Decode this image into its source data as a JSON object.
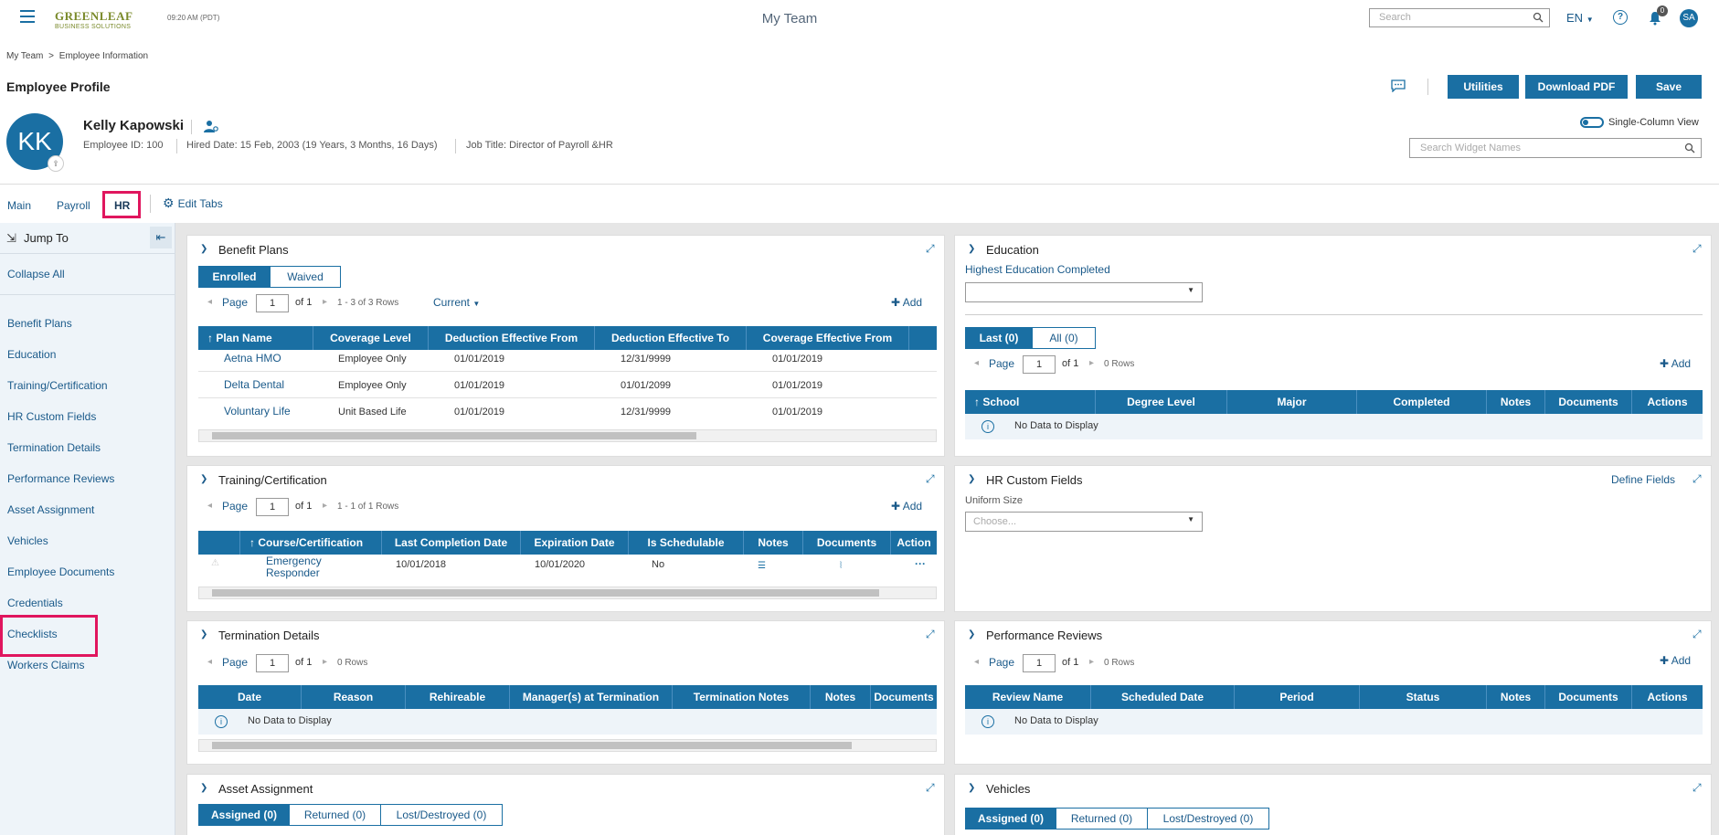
{
  "header": {
    "logo_line1": "GREENLEAF",
    "logo_line2": "BUSINESS SOLUTIONS",
    "time": "09:20 AM (PDT)",
    "app_title": "My Team",
    "search_placeholder": "Search",
    "lang": "EN",
    "notif_count": "0",
    "user_initials": "SA"
  },
  "breadcrumb": {
    "root": "My Team",
    "sep": ">",
    "current": "Employee Information"
  },
  "page_title": "Employee Profile",
  "actions": {
    "utilities": "Utilities",
    "download_pdf": "Download PDF",
    "save": "Save"
  },
  "employee": {
    "initials": "KK",
    "name": "Kelly Kapowski",
    "id_text": "Employee ID: 100",
    "hired_text": "Hired Date: 15 Feb, 2003 (19 Years, 3 Months, 16 Days)",
    "job_text": "Job Title: Director of Payroll &HR"
  },
  "view_toggle": "Single-Column View",
  "widget_search_placeholder": "Search Widget Names",
  "tabs": {
    "main": "Main",
    "payroll": "Payroll",
    "hr": "HR",
    "edit": "Edit Tabs"
  },
  "sidebar": {
    "title": "Jump To",
    "collapse_all": "Collapse All",
    "items": [
      "Benefit Plans",
      "Education",
      "Training/Certification",
      "HR Custom Fields",
      "Termination Details",
      "Performance Reviews",
      "Asset Assignment",
      "Vehicles",
      "Employee Documents",
      "Credentials",
      "Checklists",
      "Workers Claims"
    ]
  },
  "common": {
    "page": "Page",
    "page_num": "1",
    "of": "of 1",
    "add": "Add",
    "no_data": "No Data to Display",
    "zero_rows": "0 Rows"
  },
  "benefit": {
    "title": "Benefit Plans",
    "seg_enrolled": "Enrolled",
    "seg_waived": "Waived",
    "rows_info": "1 - 3 of 3 Rows",
    "filter": "Current",
    "headers": [
      "Plan Name",
      "Coverage Level",
      "Deduction Effective From",
      "Deduction Effective To",
      "Coverage Effective From"
    ],
    "rows": [
      {
        "plan": "Aetna HMO",
        "level": "Employee Only",
        "from": "01/01/2019",
        "to": "12/31/9999",
        "cov": "01/01/2019"
      },
      {
        "plan": "Delta Dental",
        "level": "Employee Only",
        "from": "01/01/2019",
        "to": "01/01/2099",
        "cov": "01/01/2019"
      },
      {
        "plan": "Voluntary Life",
        "level": "Unit Based Life",
        "from": "01/01/2019",
        "to": "12/31/9999",
        "cov": "01/01/2019"
      }
    ]
  },
  "education": {
    "title": "Education",
    "highest_label": "Highest Education Completed",
    "seg_last": "Last (0)",
    "seg_all": "All (0)",
    "headers": [
      "School",
      "Degree Level",
      "Major",
      "Completed",
      "Notes",
      "Documents",
      "Actions"
    ]
  },
  "training": {
    "title": "Training/Certification",
    "rows_info": "1 - 1 of 1 Rows",
    "headers": [
      "Course/Certification",
      "Last Completion Date",
      "Expiration Date",
      "Is Schedulable",
      "Notes",
      "Documents",
      "Action"
    ],
    "row": {
      "course_line1": "Emergency",
      "course_line2": "Responder",
      "last": "10/01/2018",
      "exp": "10/01/2020",
      "sched": "No"
    }
  },
  "hr_custom": {
    "title": "HR Custom Fields",
    "define": "Define Fields",
    "uniform_label": "Uniform Size",
    "choose": "Choose..."
  },
  "termination": {
    "title": "Termination Details",
    "headers": [
      "Date",
      "Reason",
      "Rehireable",
      "Manager(s) at Termination",
      "Termination Notes",
      "Notes",
      "Documents"
    ]
  },
  "performance": {
    "title": "Performance Reviews",
    "headers": [
      "Review Name",
      "Scheduled Date",
      "Period",
      "Status",
      "Notes",
      "Documents",
      "Actions"
    ]
  },
  "asset": {
    "title": "Asset Assignment",
    "seg_assigned": "Assigned (0)",
    "seg_returned": "Returned (0)",
    "seg_lost": "Lost/Destroyed (0)"
  },
  "vehicles": {
    "title": "Vehicles",
    "seg_assigned": "Assigned (0)",
    "seg_returned": "Returned (0)",
    "seg_lost": "Lost/Destroyed (0)"
  }
}
